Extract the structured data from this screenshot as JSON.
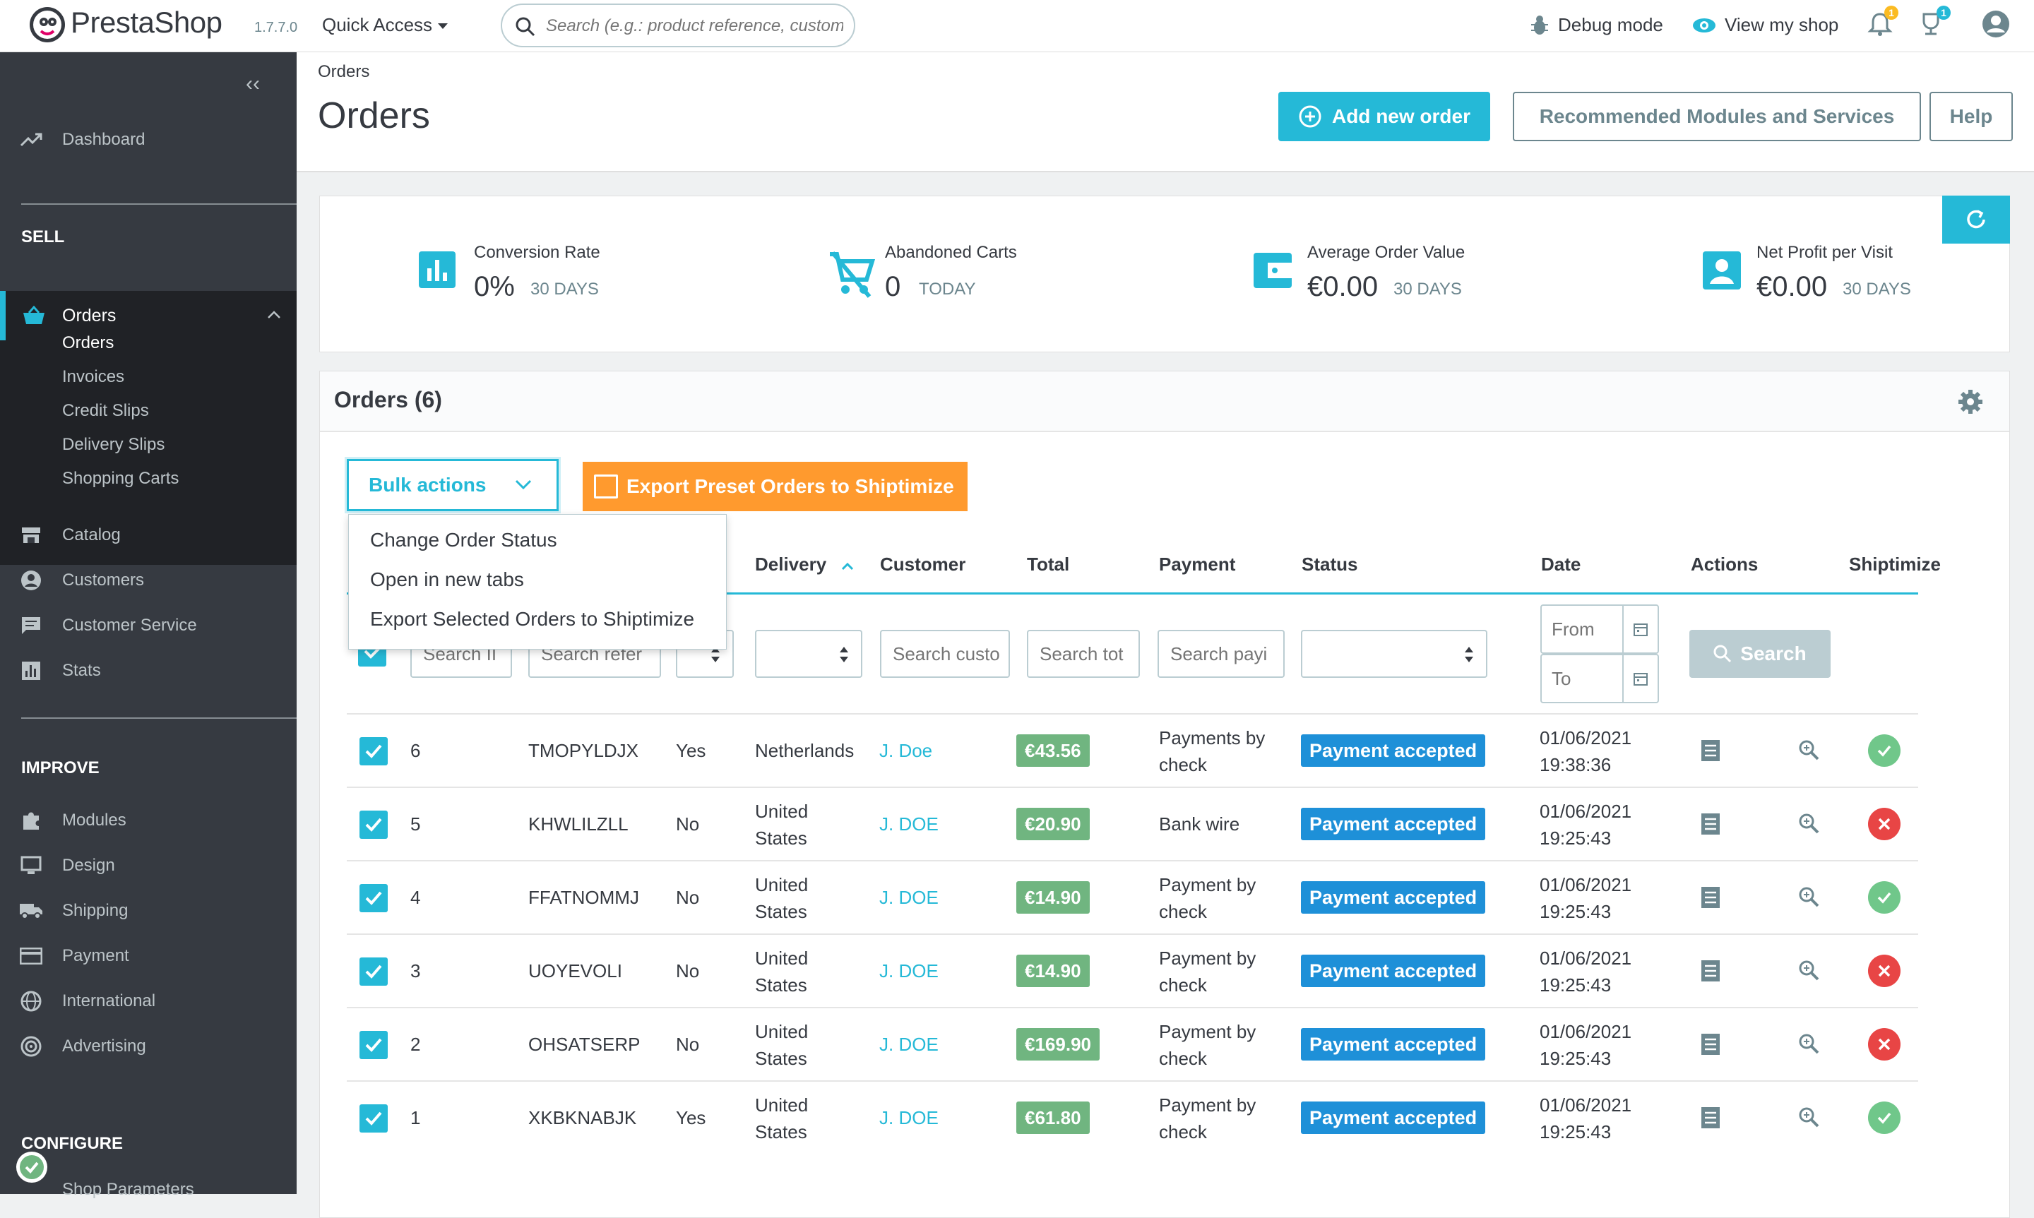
{
  "app": {
    "name": "PrestaShop",
    "version": "1.7.7.0"
  },
  "header": {
    "quick_access": "Quick Access",
    "search_placeholder": "Search (e.g.: product reference, custom",
    "debug_mode": "Debug mode",
    "view_shop": "View my shop",
    "notif_count_bell": "1",
    "notif_count_trophy": "1"
  },
  "sidebar": {
    "dashboard": "Dashboard",
    "sell_title": "SELL",
    "orders": "Orders",
    "orders_sub": [
      "Orders",
      "Invoices",
      "Credit Slips",
      "Delivery Slips",
      "Shopping Carts"
    ],
    "catalog": "Catalog",
    "customers": "Customers",
    "customer_service": "Customer Service",
    "stats": "Stats",
    "improve_title": "IMPROVE",
    "modules": "Modules",
    "design": "Design",
    "shipping": "Shipping",
    "payment": "Payment",
    "international": "International",
    "advertising": "Advertising",
    "configure_title": "CONFIGURE",
    "shop_parameters": "Shop Parameters"
  },
  "page": {
    "breadcrumb": "Orders",
    "title": "Orders",
    "add_new_order": "Add new order",
    "recommended": "Recommended Modules and Services",
    "help": "Help"
  },
  "kpis": [
    {
      "label": "Conversion Rate",
      "value": "0%",
      "period": "30 DAYS"
    },
    {
      "label": "Abandoned Carts",
      "value": "0",
      "period": "TODAY"
    },
    {
      "label": "Average Order Value",
      "value": "€0.00",
      "period": "30 DAYS"
    },
    {
      "label": "Net Profit per Visit",
      "value": "€0.00",
      "period": "30 DAYS"
    }
  ],
  "orders_panel": {
    "title": "Orders (6)",
    "bulk_actions": "Bulk actions",
    "export_preset": "Export Preset Orders to Shiptimize",
    "bulk_menu": [
      "Change Order Status",
      "Open in new tabs",
      "Export Selected Orders to Shiptimize"
    ],
    "columns": {
      "delivery": "Delivery",
      "customer": "Customer",
      "total": "Total",
      "payment": "Payment",
      "status": "Status",
      "date": "Date",
      "actions": "Actions",
      "shiptimize": "Shiptimize"
    },
    "filters": {
      "id": "Search II",
      "reference": "Search refer",
      "customer": "Search custo",
      "total": "Search tot",
      "payment": "Search payi",
      "date_from": "From",
      "date_to": "To",
      "search_button": "Search"
    },
    "rows": [
      {
        "id": "6",
        "reference": "TMOPYLDJX",
        "new_client": "Yes",
        "delivery": [
          "Netherlands"
        ],
        "customer": "J. Doe",
        "total": "€43.56",
        "payment": [
          "Payments by",
          "check"
        ],
        "status": "Payment accepted",
        "date": [
          "01/06/2021",
          "19:38:36"
        ],
        "shipped": true
      },
      {
        "id": "5",
        "reference": "KHWLILZLL",
        "new_client": "No",
        "delivery": [
          "United",
          "States"
        ],
        "customer": "J. DOE",
        "total": "€20.90",
        "payment": [
          "Bank wire"
        ],
        "status": "Payment accepted",
        "date": [
          "01/06/2021",
          "19:25:43"
        ],
        "shipped": false
      },
      {
        "id": "4",
        "reference": "FFATNOMMJ",
        "new_client": "No",
        "delivery": [
          "United",
          "States"
        ],
        "customer": "J. DOE",
        "total": "€14.90",
        "payment": [
          "Payment by",
          "check"
        ],
        "status": "Payment accepted",
        "date": [
          "01/06/2021",
          "19:25:43"
        ],
        "shipped": true
      },
      {
        "id": "3",
        "reference": "UOYEVOLI",
        "new_client": "No",
        "delivery": [
          "United",
          "States"
        ],
        "customer": "J. DOE",
        "total": "€14.90",
        "payment": [
          "Payment by",
          "check"
        ],
        "status": "Payment accepted",
        "date": [
          "01/06/2021",
          "19:25:43"
        ],
        "shipped": false
      },
      {
        "id": "2",
        "reference": "OHSATSERP",
        "new_client": "No",
        "delivery": [
          "United",
          "States"
        ],
        "customer": "J. DOE",
        "total": "€169.90",
        "payment": [
          "Payment by",
          "check"
        ],
        "status": "Payment accepted",
        "date": [
          "01/06/2021",
          "19:25:43"
        ],
        "shipped": false
      },
      {
        "id": "1",
        "reference": "XKBKNABJK",
        "new_client": "Yes",
        "delivery": [
          "United",
          "States"
        ],
        "customer": "J. DOE",
        "total": "€61.80",
        "payment": [
          "Payment by",
          "check"
        ],
        "status": "Payment accepted",
        "date": [
          "01/06/2021",
          "19:25:43"
        ],
        "shipped": true
      }
    ]
  },
  "colors": {
    "accent": "#25b9d7",
    "sidebar": "#363a41",
    "export": "#ff9a2e",
    "total": "#70b580",
    "status": "#1e90d8",
    "ok": "#70c78a",
    "fail": "#e84545"
  }
}
